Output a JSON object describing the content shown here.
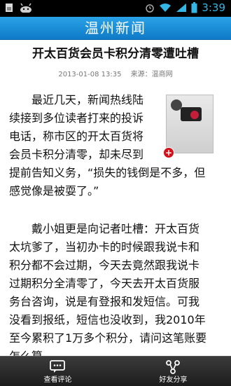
{
  "status_bar": {
    "time": "3:39",
    "icons": [
      "sim-icon",
      "android-icon",
      "alarm-icon",
      "wifi-icon",
      "signal-icon",
      "battery-icon"
    ]
  },
  "header": {
    "title": "温州新闻"
  },
  "article": {
    "title": "开太百货会员卡积分清零遭吐槽",
    "date": "2013-01-08 13:35",
    "source": "来源：温商网",
    "paragraph1_lines": [
      "　　最近几天，新闻热线陆",
      "续接到多位读者打来的投诉",
      "电话，称市区的开太百货将",
      "会员卡积分清零，却未尽到"
    ],
    "paragraph1_rest_lines": [
      "提前告知义务，“损失的钱倒是不多，但",
      "感觉像是被耍了。”"
    ],
    "paragraph2_lines": [
      "　　戴小姐更是向记者吐槽：开太百货",
      "太坑爹了，当初办卡的时候跟我说卡和",
      "积分都不会过期，今天去竟然跟我说卡",
      "过期积分全清零了，今天去开太百货服",
      "务台咨询，说是有登报和发短信。可我",
      "没看到报纸，短信也没收到，我2010年",
      "至今累积了1万多个积分，请问这笔账要",
      "怎么算"
    ]
  },
  "bottom_bar": {
    "comments_label": "查看评论",
    "share_label": "好友分享"
  }
}
